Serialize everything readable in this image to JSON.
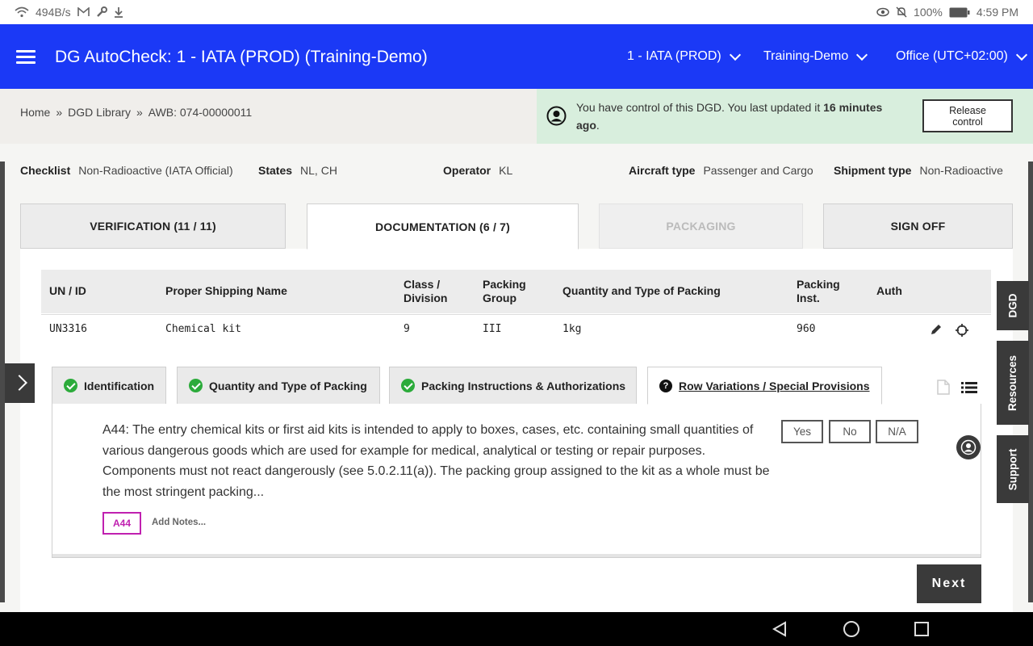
{
  "status_bar": {
    "net_speed": "494B/s",
    "battery": "100%",
    "time": "4:59 PM",
    "icons": [
      "wifi-icon",
      "gmail-icon",
      "wrench-icon",
      "download-icon",
      "eye-icon",
      "mute-icon",
      "battery-icon"
    ]
  },
  "header": {
    "title": "DG AutoCheck: 1 - IATA (PROD) (Training-Demo)",
    "environment": "1 - IATA (PROD)",
    "account": "Training-Demo",
    "office": "Office (UTC+02:00)",
    "accent_color": "#1b39f6"
  },
  "breadcrumb": {
    "home": "Home",
    "library": "DGD Library",
    "current": "AWB: 074-00000011",
    "separator": "»"
  },
  "control": {
    "message_prefix": "You have control of this DGD. You last updated it ",
    "message_bold": "16 minutes",
    "message_line2": "ago",
    "message_suffix": ".",
    "release_label_1": "Release",
    "release_label_2": "control"
  },
  "meta": {
    "checklist_label": "Checklist",
    "checklist_value": "Non-Radioactive (IATA Official)",
    "states_label": "States",
    "states_value": "NL, CH",
    "operator_label": "Operator",
    "operator_value": "KL",
    "aircraft_label": "Aircraft type",
    "aircraft_value": "Passenger and Cargo",
    "shipment_label": "Shipment type",
    "shipment_value": "Non-Radioactive"
  },
  "main_tabs": [
    {
      "label": "VERIFICATION (11 / 11)"
    },
    {
      "label": "DOCUMENTATION (6 / 7)"
    },
    {
      "label": "PACKAGING"
    },
    {
      "label": "SIGN OFF"
    }
  ],
  "table": {
    "headers": {
      "un_id": "UN / ID",
      "psn": "Proper Shipping Name",
      "class_1": "Class /",
      "class_2": "Division",
      "pg_1": "Packing",
      "pg_2": "Group",
      "qty": "Quantity and Type of Packing",
      "pi_1": "Packing",
      "pi_2": "Inst.",
      "auth": "Auth"
    },
    "row": {
      "un_id": "UN3316",
      "psn": "Chemical kit",
      "class": "9",
      "pg": "III",
      "qty": "1kg",
      "pi": "960"
    }
  },
  "sub_tabs": [
    {
      "label": "Identification",
      "status": "complete"
    },
    {
      "label": "Quantity and Type of Packing",
      "status": "complete"
    },
    {
      "label": "Packing Instructions & Authorizations",
      "status": "complete"
    },
    {
      "label": "Row Variations / Special Provisions",
      "status": "pending"
    }
  ],
  "provision": {
    "text": "A44: The entry chemical kits or first aid kits is intended to apply to boxes, cases, etc. containing small quantities of various dangerous goods which are used for example for medical, analytical or testing or repair purposes. Components must not react dangerously (see 5.0.2.11(a)). The packing group assigned to the kit as a whole must be the most stringent packing...",
    "code": "A44",
    "add_notes": "Add Notes...",
    "answers": [
      "Yes",
      "No",
      "N/A"
    ],
    "tag_color": "#c020b0"
  },
  "actions": {
    "next": "Next"
  },
  "side_tabs": [
    "DGD",
    "Resources",
    "Support"
  ]
}
